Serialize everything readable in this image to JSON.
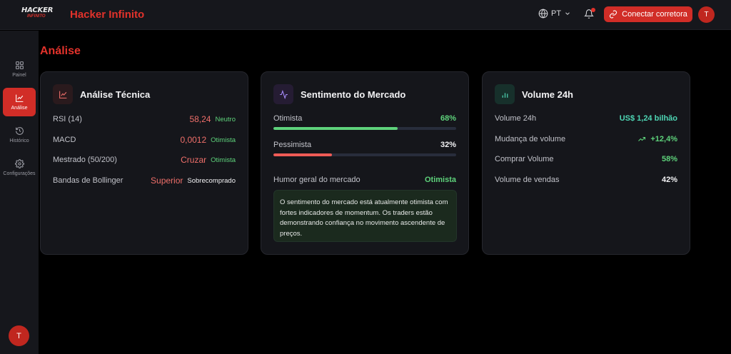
{
  "header": {
    "logo_top": "HACKER",
    "logo_bottom": "INFINITO",
    "app_title": "Hacker Infinito",
    "language": "PT",
    "connect_label": "Conectar corretora",
    "avatar_initial": "T"
  },
  "sidebar": {
    "items": [
      {
        "label": "Painel",
        "icon": "grid-icon"
      },
      {
        "label": "Análise",
        "icon": "chart-line-icon",
        "active": true
      },
      {
        "label": "Histórico",
        "icon": "history-icon"
      },
      {
        "label": "Configurações",
        "icon": "gear-icon"
      }
    ],
    "avatar_initial": "T"
  },
  "page": {
    "title": "Análise"
  },
  "technical": {
    "title": "Análise Técnica",
    "rows": [
      {
        "label": "RSI (14)",
        "value": "58,24",
        "tag": "Neutro"
      },
      {
        "label": "MACD",
        "value": "0,0012",
        "tag": "Otimista"
      },
      {
        "label": "Mestrado (50/200)",
        "value": "Cruzar",
        "tag": "Otimista"
      },
      {
        "label": "Bandas de Bollinger",
        "value": "Superior",
        "tag": "Sobrecomprado"
      }
    ]
  },
  "sentiment": {
    "title": "Sentimento do Mercado",
    "bullish_label": "Otimista",
    "bullish_value": "68%",
    "bullish_fraction": 0.68,
    "bearish_label": "Pessimista",
    "bearish_value": "32%",
    "bearish_fraction": 0.32,
    "mood_label": "Humor geral do mercado",
    "mood_value": "Otimista",
    "note": "O sentimento do mercado está atualmente otimista com fortes indicadores de momentum. Os traders estão demonstrando confiança no movimento ascendente de preços."
  },
  "volume": {
    "title": "Volume 24h",
    "rows": [
      {
        "label": "Volume 24h",
        "value": "US$ 1,24 bilhão"
      },
      {
        "label": "Mudança de volume",
        "value": "+12,4%"
      },
      {
        "label": "Comprar Volume",
        "value": "58%"
      },
      {
        "label": "Volume de vendas",
        "value": "42%"
      }
    ]
  },
  "colors": {
    "accent": "#d12d27",
    "positive": "#5ed27b",
    "negative": "#ef6f6a",
    "teal": "#4ed6b4"
  }
}
